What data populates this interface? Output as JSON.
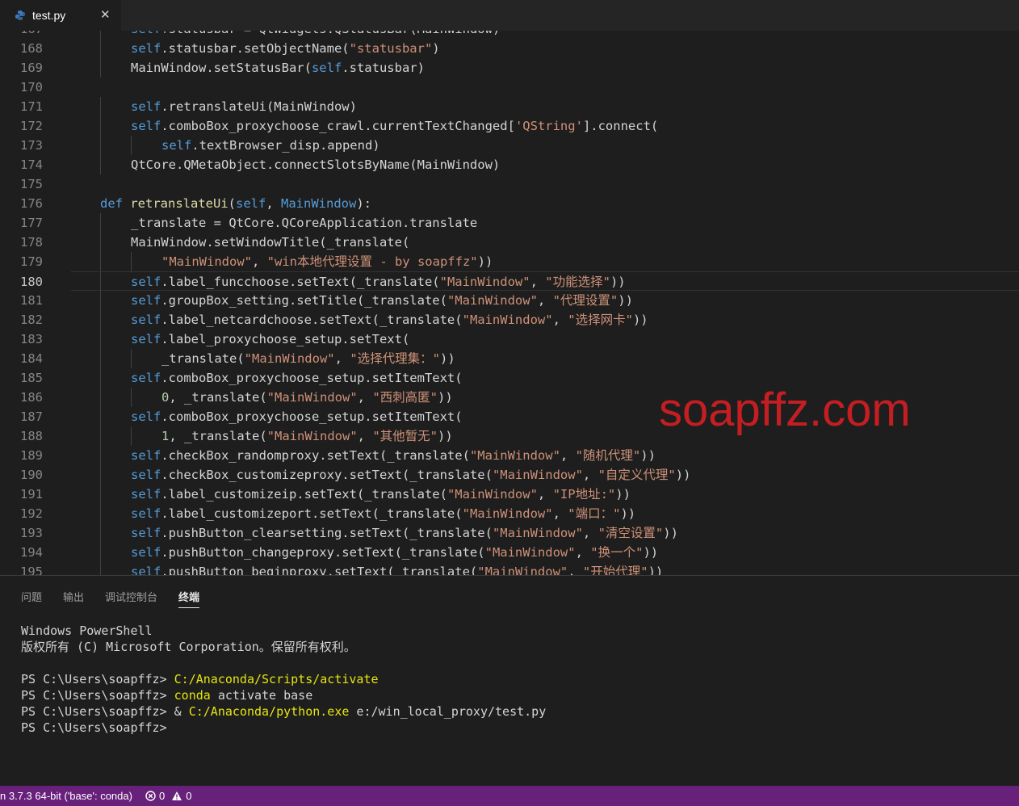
{
  "tab": {
    "filename": "test.py",
    "close_glyph": "✕",
    "icon": "python-icon"
  },
  "editor": {
    "lines": [
      {
        "n": "167",
        "indent": 2,
        "tokens": [
          [
            "self",
            "self."
          ],
          [
            "txt",
            "statusbar = QtWidgets.QStatusBar(MainWindow)"
          ]
        ]
      },
      {
        "n": "168",
        "indent": 2,
        "tokens": [
          [
            "self",
            "self"
          ],
          [
            "txt",
            ".statusbar.setObjectName("
          ],
          [
            "str",
            "\"statusbar\""
          ],
          [
            "txt",
            ")"
          ]
        ]
      },
      {
        "n": "169",
        "indent": 2,
        "tokens": [
          [
            "txt",
            "MainWindow.setStatusBar("
          ],
          [
            "self",
            "self"
          ],
          [
            "txt",
            ".statusbar)"
          ]
        ]
      },
      {
        "n": "170",
        "indent": 0,
        "tokens": []
      },
      {
        "n": "171",
        "indent": 2,
        "tokens": [
          [
            "self",
            "self"
          ],
          [
            "txt",
            ".retranslateUi(MainWindow)"
          ]
        ]
      },
      {
        "n": "172",
        "indent": 2,
        "tokens": [
          [
            "self",
            "self"
          ],
          [
            "txt",
            ".comboBox_proxychoose_crawl.currentTextChanged["
          ],
          [
            "str",
            "'QString'"
          ],
          [
            "txt",
            "].connect("
          ]
        ]
      },
      {
        "n": "173",
        "indent": 3,
        "tokens": [
          [
            "self",
            "self"
          ],
          [
            "txt",
            ".textBrowser_disp.append)"
          ]
        ]
      },
      {
        "n": "174",
        "indent": 2,
        "tokens": [
          [
            "txt",
            "QtCore.QMetaObject.connectSlotsByName(MainWindow)"
          ]
        ]
      },
      {
        "n": "175",
        "indent": 0,
        "tokens": []
      },
      {
        "n": "176",
        "indent": 1,
        "tokens": [
          [
            "kw",
            "def"
          ],
          [
            "txt",
            " "
          ],
          [
            "fn",
            "retranslateUi"
          ],
          [
            "txt",
            "("
          ],
          [
            "self",
            "self"
          ],
          [
            "txt",
            ", "
          ],
          [
            "self",
            "MainWindow"
          ],
          [
            "txt",
            "):"
          ]
        ]
      },
      {
        "n": "177",
        "indent": 2,
        "tokens": [
          [
            "txt",
            "_translate = QtCore.QCoreApplication.translate"
          ]
        ]
      },
      {
        "n": "178",
        "indent": 2,
        "tokens": [
          [
            "txt",
            "MainWindow.setWindowTitle(_translate("
          ]
        ]
      },
      {
        "n": "179",
        "indent": 3,
        "tokens": [
          [
            "str",
            "\"MainWindow\""
          ],
          [
            "txt",
            ", "
          ],
          [
            "str",
            "\"win本地代理设置 - by soapffz\""
          ],
          [
            "txt",
            "))"
          ]
        ]
      },
      {
        "n": "180",
        "indent": 2,
        "current": true,
        "tokens": [
          [
            "self",
            "self"
          ],
          [
            "txt",
            ".label_funcchoose.setText(_translate("
          ],
          [
            "str",
            "\"MainWindow\""
          ],
          [
            "txt",
            ", "
          ],
          [
            "str",
            "\"功能选择\""
          ],
          [
            "txt",
            "))"
          ]
        ]
      },
      {
        "n": "181",
        "indent": 2,
        "tokens": [
          [
            "self",
            "self"
          ],
          [
            "txt",
            ".groupBox_setting.setTitle(_translate("
          ],
          [
            "str",
            "\"MainWindow\""
          ],
          [
            "txt",
            ", "
          ],
          [
            "str",
            "\"代理设置\""
          ],
          [
            "txt",
            "))"
          ]
        ]
      },
      {
        "n": "182",
        "indent": 2,
        "tokens": [
          [
            "self",
            "self"
          ],
          [
            "txt",
            ".label_netcardchoose.setText(_translate("
          ],
          [
            "str",
            "\"MainWindow\""
          ],
          [
            "txt",
            ", "
          ],
          [
            "str",
            "\"选择网卡\""
          ],
          [
            "txt",
            "))"
          ]
        ]
      },
      {
        "n": "183",
        "indent": 2,
        "tokens": [
          [
            "self",
            "self"
          ],
          [
            "txt",
            ".label_proxychoose_setup.setText("
          ]
        ]
      },
      {
        "n": "184",
        "indent": 3,
        "tokens": [
          [
            "txt",
            "_translate("
          ],
          [
            "str",
            "\"MainWindow\""
          ],
          [
            "txt",
            ", "
          ],
          [
            "str",
            "\"选择代理集：\""
          ],
          [
            "txt",
            "))"
          ]
        ]
      },
      {
        "n": "185",
        "indent": 2,
        "tokens": [
          [
            "self",
            "self"
          ],
          [
            "txt",
            ".comboBox_proxychoose_setup.setItemText("
          ]
        ]
      },
      {
        "n": "186",
        "indent": 3,
        "tokens": [
          [
            "num",
            "0"
          ],
          [
            "txt",
            ", _translate("
          ],
          [
            "str",
            "\"MainWindow\""
          ],
          [
            "txt",
            ", "
          ],
          [
            "str",
            "\"西刺高匿\""
          ],
          [
            "txt",
            "))"
          ]
        ]
      },
      {
        "n": "187",
        "indent": 2,
        "tokens": [
          [
            "self",
            "self"
          ],
          [
            "txt",
            ".comboBox_proxychoose_setup.setItemText("
          ]
        ]
      },
      {
        "n": "188",
        "indent": 3,
        "tokens": [
          [
            "num",
            "1"
          ],
          [
            "txt",
            ", _translate("
          ],
          [
            "str",
            "\"MainWindow\""
          ],
          [
            "txt",
            ", "
          ],
          [
            "str",
            "\"其他暂无\""
          ],
          [
            "txt",
            "))"
          ]
        ]
      },
      {
        "n": "189",
        "indent": 2,
        "tokens": [
          [
            "self",
            "self"
          ],
          [
            "txt",
            ".checkBox_randomproxy.setText(_translate("
          ],
          [
            "str",
            "\"MainWindow\""
          ],
          [
            "txt",
            ", "
          ],
          [
            "str",
            "\"随机代理\""
          ],
          [
            "txt",
            "))"
          ]
        ]
      },
      {
        "n": "190",
        "indent": 2,
        "tokens": [
          [
            "self",
            "self"
          ],
          [
            "txt",
            ".checkBox_customizeproxy.setText(_translate("
          ],
          [
            "str",
            "\"MainWindow\""
          ],
          [
            "txt",
            ", "
          ],
          [
            "str",
            "\"自定义代理\""
          ],
          [
            "txt",
            "))"
          ]
        ]
      },
      {
        "n": "191",
        "indent": 2,
        "tokens": [
          [
            "self",
            "self"
          ],
          [
            "txt",
            ".label_customizeip.setText(_translate("
          ],
          [
            "str",
            "\"MainWindow\""
          ],
          [
            "txt",
            ", "
          ],
          [
            "str",
            "\"IP地址:\""
          ],
          [
            "txt",
            "))"
          ]
        ]
      },
      {
        "n": "192",
        "indent": 2,
        "tokens": [
          [
            "self",
            "self"
          ],
          [
            "txt",
            ".label_customizeport.setText(_translate("
          ],
          [
            "str",
            "\"MainWindow\""
          ],
          [
            "txt",
            ", "
          ],
          [
            "str",
            "\"端口：\""
          ],
          [
            "txt",
            "))"
          ]
        ]
      },
      {
        "n": "193",
        "indent": 2,
        "tokens": [
          [
            "self",
            "self"
          ],
          [
            "txt",
            ".pushButton_clearsetting.setText(_translate("
          ],
          [
            "str",
            "\"MainWindow\""
          ],
          [
            "txt",
            ", "
          ],
          [
            "str",
            "\"清空设置\""
          ],
          [
            "txt",
            "))"
          ]
        ]
      },
      {
        "n": "194",
        "indent": 2,
        "tokens": [
          [
            "self",
            "self"
          ],
          [
            "txt",
            ".pushButton_changeproxy.setText(_translate("
          ],
          [
            "str",
            "\"MainWindow\""
          ],
          [
            "txt",
            ", "
          ],
          [
            "str",
            "\"换一个\""
          ],
          [
            "txt",
            "))"
          ]
        ]
      },
      {
        "n": "195",
        "indent": 2,
        "tokens": [
          [
            "self",
            "self"
          ],
          [
            "txt",
            ".pushButton_beginproxy.setText(_translate("
          ],
          [
            "str",
            "\"MainWindow\""
          ],
          [
            "txt",
            ", "
          ],
          [
            "str",
            "\"开始代理\""
          ],
          [
            "txt",
            "))"
          ]
        ]
      }
    ]
  },
  "watermark": "soapffz.com",
  "panel": {
    "tabs": [
      "问题",
      "输出",
      "调试控制台",
      "终端"
    ],
    "active_tab": 3,
    "terminal": [
      [
        [
          "txt",
          "Windows PowerShell"
        ]
      ],
      [
        [
          "txt",
          "版权所有 (C) Microsoft Corporation。保留所有权利。"
        ]
      ],
      [],
      [
        [
          "txt",
          "PS C:\\Users\\soapffz> "
        ],
        [
          "ycmd",
          "C:/Anaconda/Scripts/activate"
        ]
      ],
      [
        [
          "txt",
          "PS C:\\Users\\soapffz> "
        ],
        [
          "ycmd",
          "conda"
        ],
        [
          "txt",
          " activate base"
        ]
      ],
      [
        [
          "txt",
          "PS C:\\Users\\soapffz> & "
        ],
        [
          "ycmd",
          "C:/Anaconda/python.exe"
        ],
        [
          "txt",
          " e:/win_local_proxy/test.py"
        ]
      ],
      [
        [
          "txt",
          "PS C:\\Users\\soapffz>"
        ]
      ]
    ]
  },
  "statusbar": {
    "interpreter": "n 3.7.3 64-bit ('base': conda)",
    "errors": "0",
    "warnings": "0",
    "color": "#68217a"
  }
}
